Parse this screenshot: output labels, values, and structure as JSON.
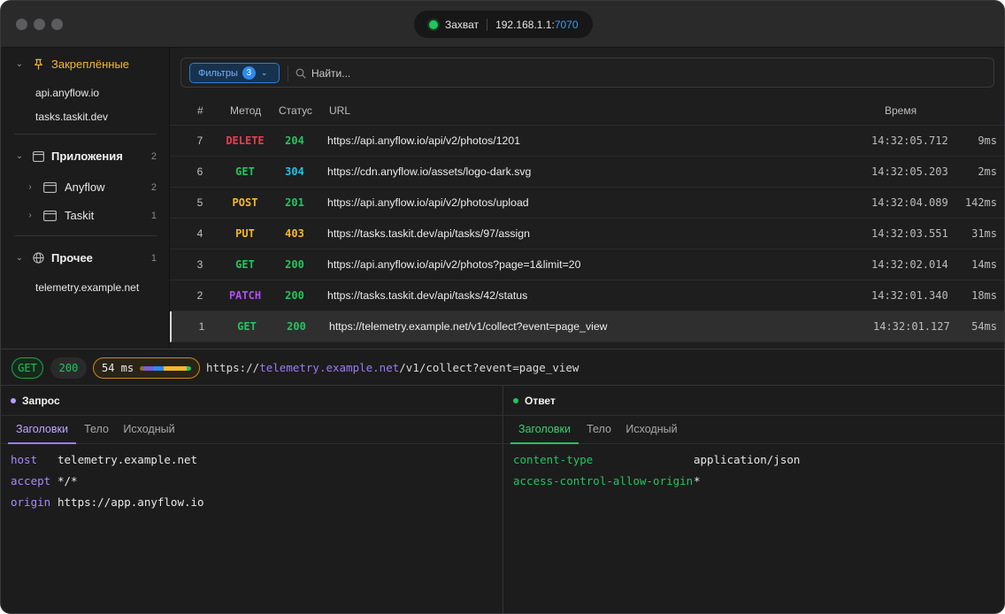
{
  "titlebar": {
    "capture_label": "Захват",
    "ip": "192.168.1.1:",
    "port": "7070"
  },
  "sidebar": {
    "pinned": {
      "label": "Закреплённые",
      "items": [
        "api.anyflow.io",
        "tasks.taskit.dev"
      ]
    },
    "apps": {
      "label": "Приложения",
      "count": "2",
      "items": [
        {
          "label": "Anyflow",
          "count": "2"
        },
        {
          "label": "Taskit",
          "count": "1"
        }
      ]
    },
    "other": {
      "label": "Прочее",
      "count": "1",
      "items": [
        "telemetry.example.net"
      ]
    }
  },
  "filterbar": {
    "filters_label": "Фильтры",
    "filters_count": "3",
    "search_placeholder": "Найти..."
  },
  "table": {
    "headers": {
      "num": "#",
      "method": "Метод",
      "status": "Статус",
      "url": "URL",
      "time": "Время"
    },
    "rows": [
      {
        "num": "7",
        "method": "DELETE",
        "status": "204",
        "url": "https://api.anyflow.io/api/v2/photos/1201",
        "time": "14:32:05.712",
        "duration": "9ms",
        "method_color": "#ef3b4d",
        "status_color": "#22c55e"
      },
      {
        "num": "6",
        "method": "GET",
        "status": "304",
        "url": "https://cdn.anyflow.io/assets/logo-dark.svg",
        "time": "14:32:05.203",
        "duration": "2ms",
        "method_color": "#22c55e",
        "status_color": "#22c3e6"
      },
      {
        "num": "5",
        "method": "POST",
        "status": "201",
        "url": "https://api.anyflow.io/api/v2/photos/upload",
        "time": "14:32:04.089",
        "duration": "142ms",
        "method_color": "#f4b92a",
        "status_color": "#22c55e"
      },
      {
        "num": "4",
        "method": "PUT",
        "status": "403",
        "url": "https://tasks.taskit.dev/api/tasks/97/assign",
        "time": "14:32:03.551",
        "duration": "31ms",
        "method_color": "#f4b92a",
        "status_color": "#f4b92a"
      },
      {
        "num": "3",
        "method": "GET",
        "status": "200",
        "url": "https://api.anyflow.io/api/v2/photos?page=1&limit=20",
        "time": "14:32:02.014",
        "duration": "14ms",
        "method_color": "#22c55e",
        "status_color": "#22c55e"
      },
      {
        "num": "2",
        "method": "PATCH",
        "status": "200",
        "url": "https://tasks.taskit.dev/api/tasks/42/status",
        "time": "14:32:01.340",
        "duration": "18ms",
        "method_color": "#b150f0",
        "status_color": "#22c55e"
      },
      {
        "num": "1",
        "method": "GET",
        "status": "200",
        "url": "https://telemetry.example.net/v1/collect?event=page_view",
        "time": "14:32:01.127",
        "duration": "54ms",
        "method_color": "#22c55e",
        "status_color": "#22c55e"
      }
    ]
  },
  "detail": {
    "method": "GET",
    "status": "200",
    "timing": "54 ms",
    "url_scheme": "https://",
    "url_host": "telemetry.example.net",
    "url_path": "/v1/collect?event=page_view"
  },
  "request": {
    "title": "Запрос",
    "tabs": [
      "Заголовки",
      "Тело",
      "Исходный"
    ],
    "headers": [
      {
        "key": "host",
        "value": "telemetry.example.net"
      },
      {
        "key": "accept",
        "value": "*/*"
      },
      {
        "key": "origin",
        "value": "https://app.anyflow.io"
      }
    ]
  },
  "response": {
    "title": "Ответ",
    "tabs": [
      "Заголовки",
      "Тело",
      "Исходный"
    ],
    "headers": [
      {
        "key": "content-type",
        "value": "application/json"
      },
      {
        "key": "access-control-allow-origin",
        "value": "*"
      }
    ]
  }
}
